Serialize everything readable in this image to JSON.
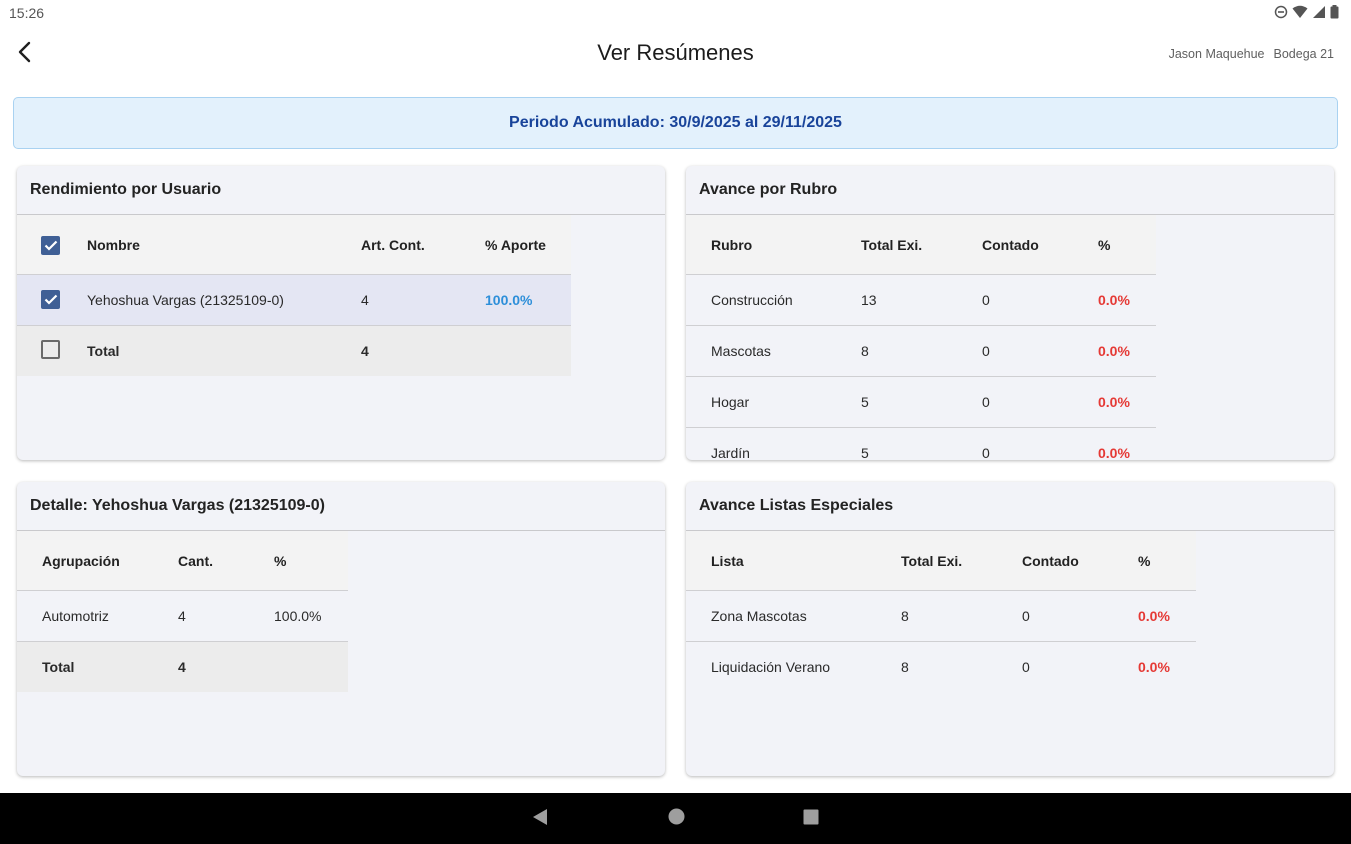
{
  "status_bar": {
    "time": "15:26",
    "icons": [
      "dnd-icon",
      "wifi-icon",
      "signal-icon",
      "battery-icon"
    ]
  },
  "app_bar": {
    "title": "Ver Resúmenes",
    "user_name": "Jason Maquehue",
    "warehouse": "Bodega 21",
    "back_icon": "back-arrow-icon"
  },
  "period_banner": {
    "text": "Periodo Acumulado: 30/9/2025 al 29/11/2025"
  },
  "colors": {
    "accent": "#3f5f95",
    "banner_bg": "#e3f1fc",
    "banner_text": "#19449a",
    "pct_positive": "#2d8fd9",
    "pct_zero": "#e53935"
  },
  "user_performance": {
    "title": "Rendimiento por Usuario",
    "columns": [
      "Nombre",
      "Art. Cont.",
      "% Aporte"
    ],
    "header_checked": true,
    "rows": [
      {
        "name": "Yehoshua Vargas (21325109-0)",
        "count": "4",
        "pct": "100.0%",
        "checked": true
      }
    ],
    "total": {
      "label": "Total",
      "count": "4",
      "checked": false
    }
  },
  "category_progress": {
    "title": "Avance por Rubro",
    "columns": [
      "Rubro",
      "Total Exi.",
      "Contado",
      "%"
    ],
    "rows": [
      {
        "name": "Construcción",
        "total": "13",
        "counted": "0",
        "pct": "0.0%"
      },
      {
        "name": "Mascotas",
        "total": "8",
        "counted": "0",
        "pct": "0.0%"
      },
      {
        "name": "Hogar",
        "total": "5",
        "counted": "0",
        "pct": "0.0%"
      },
      {
        "name": "Jardín",
        "total": "5",
        "counted": "0",
        "pct": "0.0%"
      }
    ]
  },
  "user_detail": {
    "title": "Detalle: Yehoshua Vargas (21325109-0)",
    "columns": [
      "Agrupación",
      "Cant.",
      "%"
    ],
    "rows": [
      {
        "group": "Automotriz",
        "qty": "4",
        "pct": "100.0%"
      }
    ],
    "total": {
      "label": "Total",
      "qty": "4"
    }
  },
  "special_lists": {
    "title": "Avance Listas Especiales",
    "columns": [
      "Lista",
      "Total Exi.",
      "Contado",
      "%"
    ],
    "rows": [
      {
        "name": "Zona Mascotas",
        "total": "8",
        "counted": "0",
        "pct": "0.0%"
      },
      {
        "name": "Liquidación Verano",
        "total": "8",
        "counted": "0",
        "pct": "0.0%"
      }
    ]
  },
  "nav_bar": {
    "icons": [
      "nav-back-icon",
      "nav-home-icon",
      "nav-recents-icon"
    ]
  }
}
